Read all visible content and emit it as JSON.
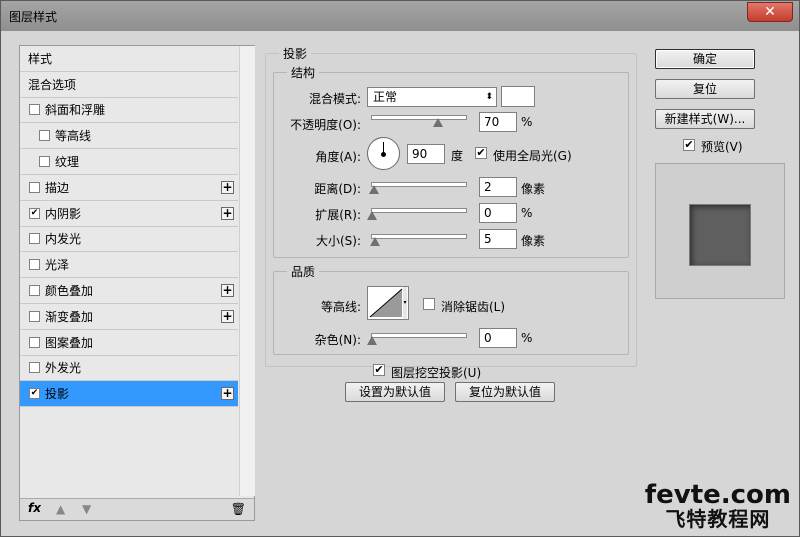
{
  "window": {
    "title": "图层样式",
    "close_icon": "✕"
  },
  "left_list": {
    "items": [
      {
        "label": "样式",
        "checkbox": false,
        "checked": false,
        "plus": false,
        "indent": false,
        "selected": false
      },
      {
        "label": "混合选项",
        "checkbox": false,
        "checked": false,
        "plus": false,
        "indent": false,
        "selected": false
      },
      {
        "label": "斜面和浮雕",
        "checkbox": true,
        "checked": false,
        "plus": false,
        "indent": false,
        "selected": false
      },
      {
        "label": "等高线",
        "checkbox": true,
        "checked": false,
        "plus": false,
        "indent": true,
        "selected": false
      },
      {
        "label": "纹理",
        "checkbox": true,
        "checked": false,
        "plus": false,
        "indent": true,
        "selected": false
      },
      {
        "label": "描边",
        "checkbox": true,
        "checked": false,
        "plus": true,
        "indent": false,
        "selected": false
      },
      {
        "label": "内阴影",
        "checkbox": true,
        "checked": true,
        "plus": true,
        "indent": false,
        "selected": false
      },
      {
        "label": "内发光",
        "checkbox": true,
        "checked": false,
        "plus": false,
        "indent": false,
        "selected": false
      },
      {
        "label": "光泽",
        "checkbox": true,
        "checked": false,
        "plus": false,
        "indent": false,
        "selected": false
      },
      {
        "label": "颜色叠加",
        "checkbox": true,
        "checked": false,
        "plus": true,
        "indent": false,
        "selected": false
      },
      {
        "label": "渐变叠加",
        "checkbox": true,
        "checked": false,
        "plus": true,
        "indent": false,
        "selected": false
      },
      {
        "label": "图案叠加",
        "checkbox": true,
        "checked": false,
        "plus": false,
        "indent": false,
        "selected": false
      },
      {
        "label": "外发光",
        "checkbox": true,
        "checked": false,
        "plus": false,
        "indent": false,
        "selected": false
      },
      {
        "label": "投影",
        "checkbox": true,
        "checked": true,
        "plus": true,
        "indent": false,
        "selected": true
      }
    ],
    "footer": {
      "fx": "fx",
      "up_icon": "▲",
      "down_icon": "▼",
      "trash_icon": "🗑"
    }
  },
  "drop_shadow": {
    "title": "投影",
    "structure": {
      "title": "结构",
      "blend_mode_label": "混合模式:",
      "blend_mode_value": "正常",
      "opacity_label": "不透明度(O):",
      "opacity_value": "70",
      "opacity_unit": "%",
      "opacity_level": 0.7,
      "angle_label": "角度(A):",
      "angle_value": "90",
      "angle_unit": "度",
      "global_light_label": "使用全局光(G)",
      "global_light_checked": true,
      "distance_label": "距离(D):",
      "distance_value": "2",
      "distance_unit": "像素",
      "spread_label": "扩展(R):",
      "spread_value": "0",
      "spread_unit": "%",
      "size_label": "大小(S):",
      "size_value": "5",
      "size_unit": "像素"
    },
    "quality": {
      "title": "品质",
      "contour_label": "等高线:",
      "antialias_label": "消除锯齿(L)",
      "antialias_checked": false,
      "noise_label": "杂色(N):",
      "noise_value": "0",
      "noise_unit": "%"
    },
    "knockout_label": "图层挖空投影(U)",
    "knockout_checked": true,
    "make_default_button": "设置为默认值",
    "reset_default_button": "复位为默认值"
  },
  "right_panel": {
    "ok_button": "确定",
    "reset_button": "复位",
    "new_style_button": "新建样式(W)...",
    "preview_label": "预览(V)",
    "preview_checked": true
  },
  "watermark": {
    "line1": "fevte.com",
    "line2": "飞特教程网"
  },
  "colors": {
    "selected_row": "#3399ff",
    "dialog_bg": "#d6d6d6",
    "preview_swatch": "#5f5f5f"
  }
}
